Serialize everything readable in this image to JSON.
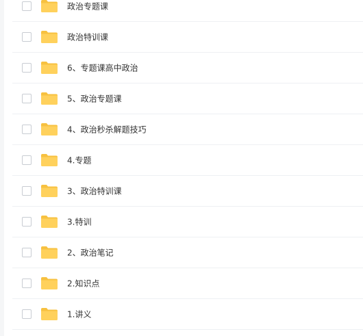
{
  "files": [
    {
      "name": "政治专题课",
      "icon": "folder-icon"
    },
    {
      "name": "政治特训课",
      "icon": "folder-icon"
    },
    {
      "name": "6、专题课高中政治",
      "icon": "folder-icon"
    },
    {
      "name": "5、政治专题课",
      "icon": "folder-icon"
    },
    {
      "name": "4、政治秒杀解题技巧",
      "icon": "folder-icon"
    },
    {
      "name": "4.专题",
      "icon": "folder-icon"
    },
    {
      "name": "3、政治特训课",
      "icon": "folder-icon"
    },
    {
      "name": "3.特训",
      "icon": "folder-icon"
    },
    {
      "name": "2、政治笔记",
      "icon": "folder-icon"
    },
    {
      "name": "2.知识点",
      "icon": "folder-icon"
    },
    {
      "name": "1.讲义",
      "icon": "folder-icon"
    }
  ],
  "colors": {
    "folder_body": "#FFD15C",
    "folder_tab": "#F7C140",
    "row_divider": "#EEF0F3",
    "checkbox_border": "#C8CCD2",
    "text": "#333333"
  }
}
